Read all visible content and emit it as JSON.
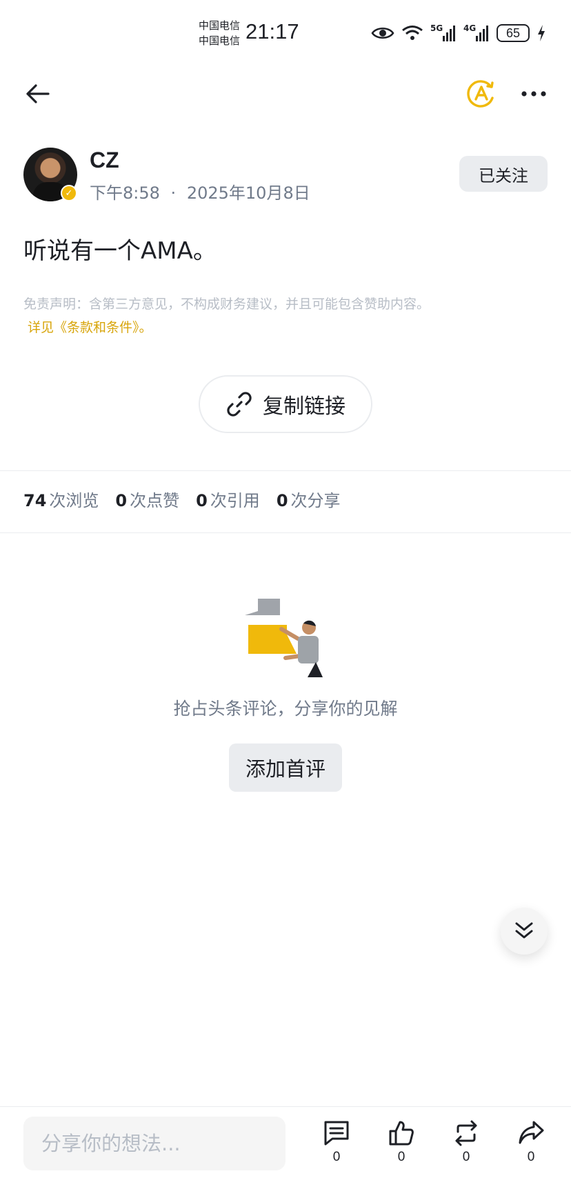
{
  "status_bar": {
    "carrier_1": "中国电信",
    "carrier_2": "中国电信",
    "time": "21:17",
    "net_1": "5G",
    "net_2": "4G",
    "battery": "65"
  },
  "author": {
    "name": "CZ",
    "time": "下午8:58",
    "separator": "·",
    "date": "2025年10月8日",
    "follow_label": "已关注"
  },
  "post": {
    "text": "听说有一个AMA。",
    "disclaimer": "免责声明：含第三方意见，不构成财务建议，并且可能包含赞助内容。",
    "terms_link": "详见《条款和条件》。",
    "copy_link_label": "复制链接"
  },
  "stats": [
    {
      "value": "74",
      "label": "次浏览"
    },
    {
      "value": "0",
      "label": "次点赞"
    },
    {
      "value": "0",
      "label": "次引用"
    },
    {
      "value": "0",
      "label": "次分享"
    }
  ],
  "empty_state": {
    "text": "抢占头条评论，分享你的见解",
    "button_label": "添加首评"
  },
  "bottom_bar": {
    "input_placeholder": "分享你的想法...",
    "comment_count": "0",
    "like_count": "0",
    "quote_count": "0",
    "share_count": "0"
  },
  "colors": {
    "accent": "#f0b90b",
    "link": "#d8a50b",
    "text_primary": "#1e2026",
    "text_secondary": "#707a8a",
    "text_muted": "#b7bdc6",
    "button_bg": "#eaecef"
  },
  "icons": [
    "back-arrow-icon",
    "translate-icon",
    "more-icon",
    "link-icon",
    "double-chevron-down-icon",
    "comment-icon",
    "thumbs-up-icon",
    "repost-icon",
    "share-icon"
  ]
}
